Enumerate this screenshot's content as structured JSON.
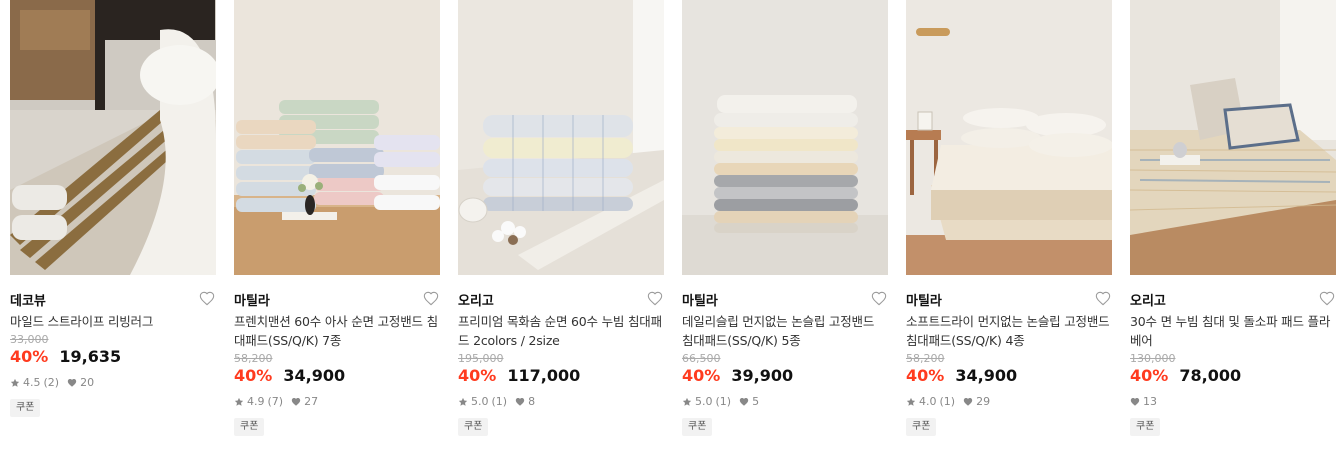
{
  "products": [
    {
      "brand": "데코뷰",
      "title": "마일드 스트라이프 리빙러그",
      "original_price": "33,000",
      "discount": "40%",
      "price": "19,635",
      "rating": "4.5",
      "reviews": "(2)",
      "likes": "20",
      "coupon": "쿠폰"
    },
    {
      "brand": "마틸라",
      "title": "프렌치맨션 60수 아사 순면 고정밴드 침대패드(SS/Q/K) 7종",
      "original_price": "58,200",
      "discount": "40%",
      "price": "34,900",
      "rating": "4.9",
      "reviews": "(7)",
      "likes": "27",
      "coupon": "쿠폰"
    },
    {
      "brand": "오리고",
      "title": "프리미엄 목화솜 순면 60수 누빔 침대패드 2colors / 2size",
      "original_price": "195,000",
      "discount": "40%",
      "price": "117,000",
      "rating": "5.0",
      "reviews": "(1)",
      "likes": "8",
      "coupon": "쿠폰"
    },
    {
      "brand": "마틸라",
      "title": "데일리슬립 먼지없는 논슬립 고정밴드 침대패드(SS/Q/K) 5종",
      "original_price": "66,500",
      "discount": "40%",
      "price": "39,900",
      "rating": "5.0",
      "reviews": "(1)",
      "likes": "5",
      "coupon": "쿠폰"
    },
    {
      "brand": "마틸라",
      "title": "소프트드라이 먼지없는 논슬립 고정밴드 침대패드(SS/Q/K) 4종",
      "original_price": "58,200",
      "discount": "40%",
      "price": "34,900",
      "rating": "4.0",
      "reviews": "(1)",
      "likes": "29",
      "coupon": "쿠폰"
    },
    {
      "brand": "오리고",
      "title": "30수 면 누빔 침대 및 돌소파 패드 플라베어",
      "original_price": "130,000",
      "discount": "40%",
      "price": "78,000",
      "likes": "13",
      "coupon": "쿠폰"
    }
  ],
  "icons": {
    "wishlist": "heart-outline-icon",
    "rating": "star-icon",
    "likes": "heart-filled-icon"
  },
  "colors": {
    "discount": "#ff3b1f",
    "meta": "#888888",
    "coupon_bg": "#f2f2f2"
  }
}
